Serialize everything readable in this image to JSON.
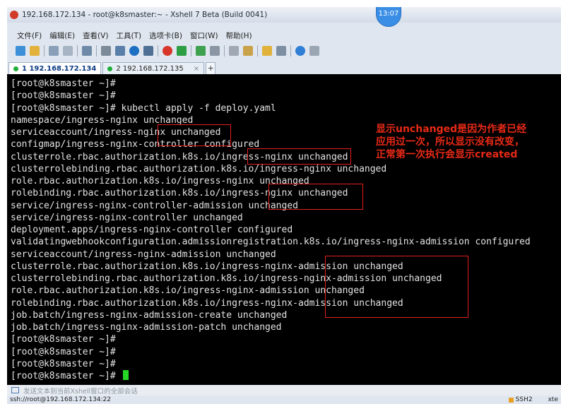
{
  "window": {
    "title": "192.168.172.134 - root@k8smaster:~ - Xshell 7 Beta (Build 0041)",
    "clock": "13:07"
  },
  "menu": [
    "文件(F)",
    "编辑(E)",
    "查看(V)",
    "工具(T)",
    "选项卡(B)",
    "窗口(W)",
    "帮助(H)"
  ],
  "toolbar_icons": [
    "new-session-icon",
    "open-folder-icon",
    "connect-icon",
    "disconnect-icon",
    "reconnect-icon",
    "find-icon",
    "copy-icon",
    "color-scheme-icon",
    "font-icon",
    "xftp-icon",
    "record-icon",
    "fullscreen-icon",
    "lock-icon",
    "keyboard-icon",
    "script-icon",
    "transfer-icon",
    "layout-icon",
    "help-icon",
    "chat-icon"
  ],
  "tabs": [
    {
      "label": "1 192.168.172.134",
      "active": true
    },
    {
      "label": "2 192.168.172.135",
      "active": false
    }
  ],
  "terminal": {
    "lines": [
      "[root@k8smaster ~]#",
      "[root@k8smaster ~]#",
      "[root@k8smaster ~]# kubectl apply -f deploy.yaml",
      "namespace/ingress-nginx unchanged",
      "serviceaccount/ingress-nginx unchanged",
      "configmap/ingress-nginx-controller configured",
      "clusterrole.rbac.authorization.k8s.io/ingress-nginx unchanged",
      "clusterrolebinding.rbac.authorization.k8s.io/ingress-nginx unchanged",
      "role.rbac.authorization.k8s.io/ingress-nginx unchanged",
      "rolebinding.rbac.authorization.k8s.io/ingress-nginx unchanged",
      "service/ingress-nginx-controller-admission unchanged",
      "service/ingress-nginx-controller unchanged",
      "deployment.apps/ingress-nginx-controller configured",
      "validatingwebhookconfiguration.admissionregistration.k8s.io/ingress-nginx-admission configured",
      "serviceaccount/ingress-nginx-admission unchanged",
      "clusterrole.rbac.authorization.k8s.io/ingress-nginx-admission unchanged",
      "clusterrolebinding.rbac.authorization.k8s.io/ingress-nginx-admission unchanged",
      "role.rbac.authorization.k8s.io/ingress-nginx-admission unchanged",
      "rolebinding.rbac.authorization.k8s.io/ingress-nginx-admission unchanged",
      "job.batch/ingress-nginx-admission-create unchanged",
      "job.batch/ingress-nginx-admission-patch unchanged",
      "[root@k8smaster ~]#",
      "[root@k8smaster ~]#",
      "[root@k8smaster ~]#",
      "[root@k8smaster ~]# "
    ],
    "annotation": [
      "显示unchanged是因为作者已经",
      "应用过一次，所以显示没有改变，",
      "正常第一次执行会显示created"
    ]
  },
  "compose": {
    "placeholder": "发送文本到当前Xshell窗口的全部会话"
  },
  "status": {
    "left": "ssh://root@192.168.172.134:22",
    "protocol": "SSH2",
    "extra": "xte"
  },
  "colors": {
    "annotation": "#e82a16",
    "cursor": "#26d826",
    "terminal_bg": "#000000",
    "terminal_fg": "#e3e3e3"
  }
}
